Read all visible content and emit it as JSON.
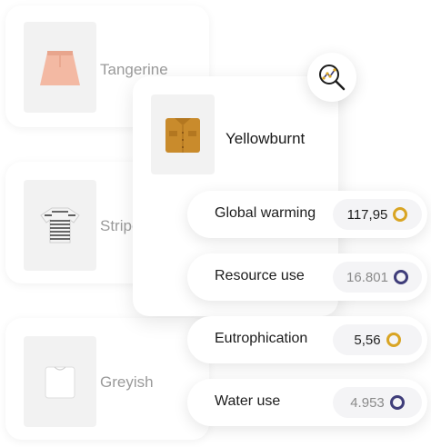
{
  "products": [
    {
      "name": "Tangerine",
      "icon": "skirt-icon"
    },
    {
      "name": "Stripe",
      "icon": "striped-tshirt-icon"
    },
    {
      "name": "Greyish",
      "icon": "folded-shirt-icon"
    }
  ],
  "selected_product": {
    "name": "Yellowburnt",
    "icon": "folded-shirt-icon"
  },
  "search_icon": "magnifier-chart-icon",
  "metrics": [
    {
      "label": "Global warming",
      "value": "117,95",
      "ring_color": "#d9a524"
    },
    {
      "label": "Resource use",
      "value": "16.801",
      "ring_color": "#3f3d7a"
    },
    {
      "label": "Eutrophication",
      "value": "5,56",
      "ring_color": "#d9a524"
    },
    {
      "label": "Water use",
      "value": "4.953",
      "ring_color": "#3f3d7a"
    }
  ]
}
